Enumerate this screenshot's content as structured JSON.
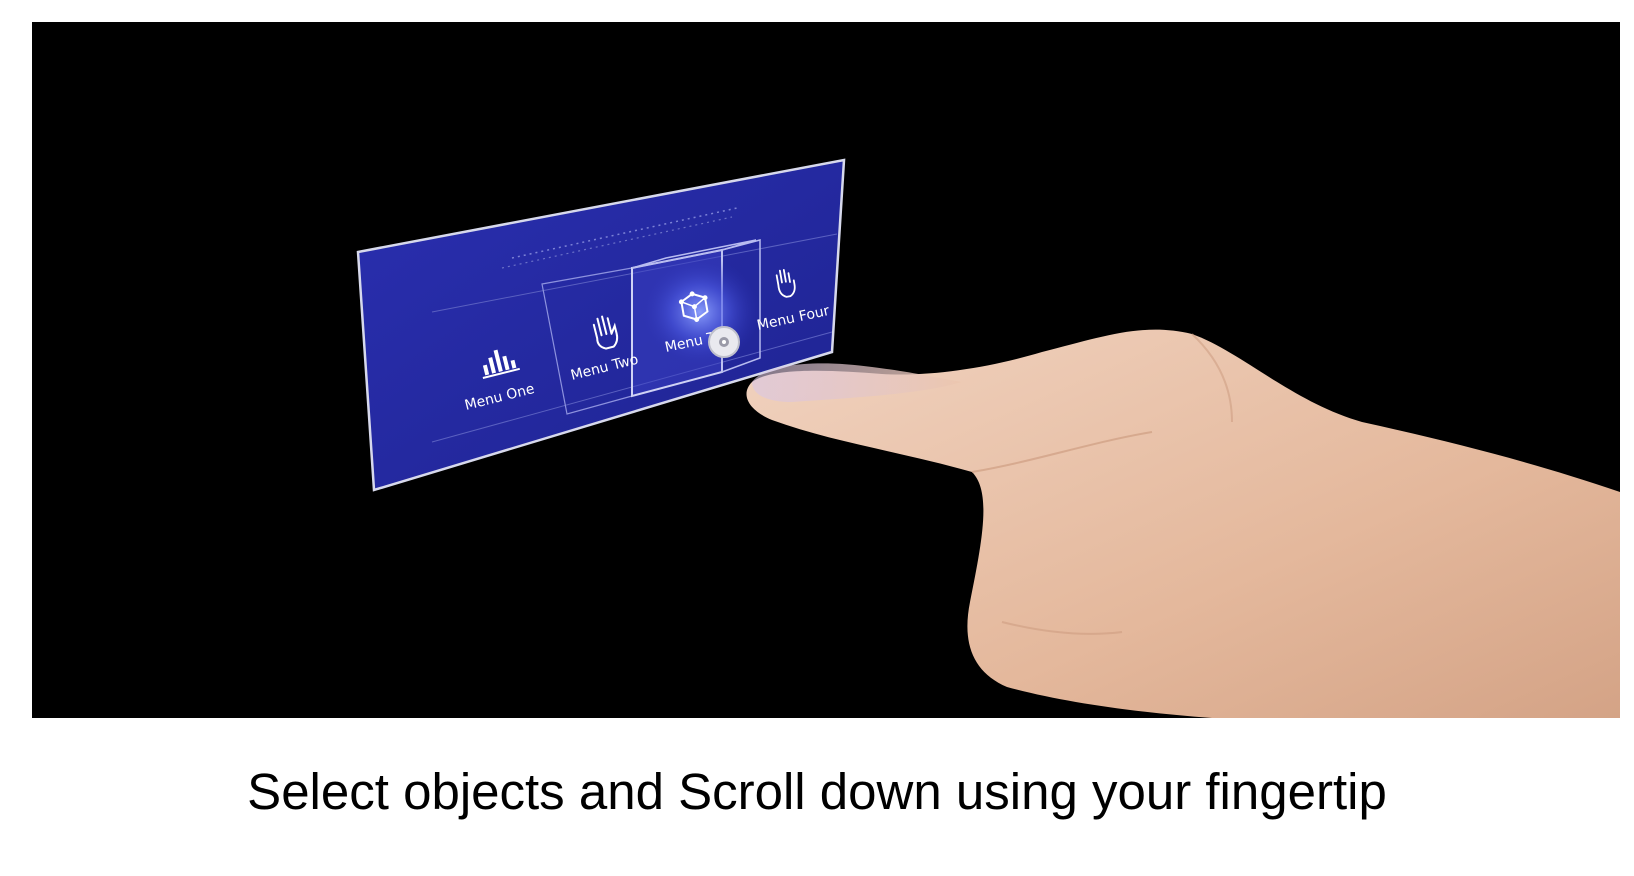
{
  "scene": {
    "menu_items": [
      {
        "label": "Menu One",
        "icon": "bar-chart-icon"
      },
      {
        "label": "Menu Two",
        "icon": "hand-icon"
      },
      {
        "label": "Menu Th",
        "icon": "cube-network-icon"
      },
      {
        "label": "Menu Four",
        "icon": "hand-gesture-icon"
      }
    ],
    "selected_index": 2,
    "colors": {
      "panel": "#2a2fa8",
      "panel_edge": "#c9cbe0",
      "background": "#000000",
      "skin": "#e8c2aa"
    }
  },
  "caption": {
    "text": "Select objects and Scroll down using your fingertip"
  }
}
